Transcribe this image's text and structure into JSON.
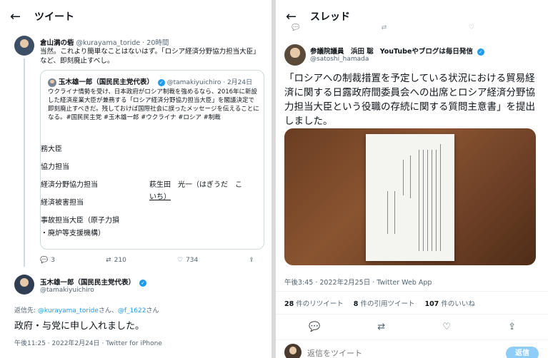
{
  "left": {
    "header": {
      "back": "←",
      "title": "ツイート"
    },
    "top_tweet": {
      "name": "倉山満の砦",
      "handle": "@kurayama_toride · 20時間",
      "text": "当然。これより簡単なことはないはず。「ロシア経済分野協力担当大臣」など、即刻廃止すべし。",
      "quote": {
        "name": "玉木雄一郎（国民民主党代表）",
        "handle": "@tamakiyuichiro · 2月24日",
        "text": "ウクライナ情勢を受け、日本政府がロシア制裁を強めるなら、2016年に新設した経済産業大臣が兼務する「ロシア経済分野協力担当大臣」を閣議決定で即刻廃止すべきだ。残しておけば国際社会に誤ったメッセージを伝えることになる。#国民民主党 #玉木雄一郎 #ウクライナ #ロシア #制裁"
      },
      "table": {
        "col1": [
          "務大臣",
          "協力担当",
          "経済分野協力担当",
          "経済被害担当",
          "事故担当大臣（原子力損",
          "・廃炉等支援機構）"
        ],
        "col2": [
          "萩生田　光一（はぎうだ　こ",
          "いち）"
        ]
      },
      "actions": {
        "reply": "3",
        "retweet": "210",
        "like": "734"
      }
    },
    "reply_tweet": {
      "name": "玉木雄一郎（国民民主党代表）",
      "handle": "@tamakiyuichiro",
      "reply_to_prefix": "返信先:",
      "reply_to_1": "@kurayama_toride",
      "reply_to_mid": "さん、",
      "reply_to_2": "@f_1622",
      "reply_to_suffix": "さん",
      "text": "政府・与党に申し入れました。",
      "meta": "午後11:25 · 2022年2月24日 · Twitter for iPhone"
    }
  },
  "right": {
    "header": {
      "back": "←",
      "title": "スレッド"
    },
    "prev_actions": {
      "reply": "",
      "retweet": "",
      "like": ""
    },
    "tweet": {
      "name": "参議院議員　浜田 聡",
      "handle": "@satoshi_hamada",
      "name_suffix": "YouTubeやブログは毎日発信",
      "text": "「ロシアへの制裁措置を予定している状況における貿易経済に関する日露政府間委員会への出席とロシア経済分野協力担当大臣という役職の存続に関する質問主意書」を提出しました。",
      "meta": "午後3:45 · 2022年2月25日 · Twitter Web App",
      "stats": [
        {
          "count": "28",
          "label": "件のリツイート"
        },
        {
          "count": "8",
          "label": "件の引用ツイート"
        },
        {
          "count": "107",
          "label": "件のいいね"
        }
      ],
      "reply_placeholder": "返信をツイート",
      "reply_button": "返信"
    }
  },
  "colors": {
    "link": "#1d9bf0",
    "muted": "#536471",
    "photo": "#6a3d22"
  }
}
